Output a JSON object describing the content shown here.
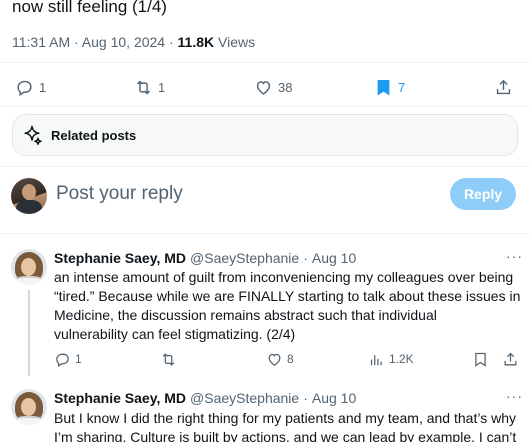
{
  "tweet": {
    "text_tail": "now still feeling (1/4)",
    "time": "11:31 AM",
    "date": "Aug 10, 2024",
    "views_count": "11.8K",
    "views_label": "Views",
    "replies": "1",
    "reposts": "1",
    "likes": "38",
    "bookmarks": "7"
  },
  "related": {
    "label": "Related posts"
  },
  "reply_box": {
    "placeholder": "Post your reply",
    "button_label": "Reply"
  },
  "replies": [
    {
      "name": "Stephanie Saey, MD",
      "handle": "@SaeyStephanie",
      "date": "Aug 10",
      "more": "···",
      "lines": [
        "an intense amount of guilt from inconveniencing my colleagues over being",
        "“tired.” Because while we are FINALLY starting to talk about these issues in",
        "Medicine, the discussion remains abstract  such that individual",
        "vulnerability can feel stigmatizing. (2/4)"
      ],
      "replies": "1",
      "reposts": "",
      "likes": "8",
      "views": "1.2K"
    },
    {
      "name": "Stephanie Saey, MD",
      "handle": "@SaeyStephanie",
      "date": "Aug 10",
      "more": "···",
      "lines": [
        "But I know I did the right thing for my patients and my team, and that’s why",
        "I’m sharing. Culture is built by actions, and we can lead by example. I can’t"
      ]
    }
  ],
  "colors": {
    "accent": "#1d9bf0",
    "muted": "#536471",
    "reply_button": "#8ecdf8"
  }
}
